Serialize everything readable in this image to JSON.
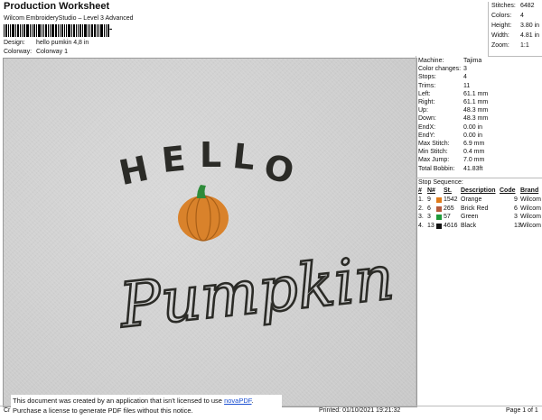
{
  "header": {
    "title": "Production Worksheet",
    "subtitle": "Wilcom EmbroideryStudio – Level 3 Advanced"
  },
  "barcode_text": "-",
  "design": {
    "label": "Design:",
    "value": "hello pumkin 4,8 in"
  },
  "colorway": {
    "label": "Colorway:",
    "value": "Colorway 1"
  },
  "stats": [
    {
      "label": "Stitches:",
      "value": "6482"
    },
    {
      "label": "Colors:",
      "value": "4"
    },
    {
      "label": "Height:",
      "value": "3.80 in"
    },
    {
      "label": "Width:",
      "value": "4.81 in"
    },
    {
      "label": "Zoom:",
      "value": "1:1"
    }
  ],
  "machine": [
    {
      "label": "Machine:",
      "value": "Tajima"
    },
    {
      "label": "Color changes:",
      "value": "3"
    },
    {
      "label": "Stops:",
      "value": "4"
    },
    {
      "label": "Trims:",
      "value": "11"
    },
    {
      "label": "Left:",
      "value": "61.1 mm"
    },
    {
      "label": "Right:",
      "value": "61.1 mm"
    },
    {
      "label": "Up:",
      "value": "48.3 mm"
    },
    {
      "label": "Down:",
      "value": "48.3 mm"
    },
    {
      "label": "EndX:",
      "value": "0.00 in"
    },
    {
      "label": "EndY:",
      "value": "0.00 in"
    },
    {
      "label": "Max Stitch:",
      "value": "6.9 mm"
    },
    {
      "label": "Min Stitch:",
      "value": "0.4 mm"
    },
    {
      "label": "Max Jump:",
      "value": "7.0 mm"
    },
    {
      "label": "Total Bobbin:",
      "value": "41.83ft"
    }
  ],
  "stop_sequence": {
    "title": "Stop Sequence:",
    "headers": [
      "#",
      "N#",
      "St.",
      "Description",
      "Code",
      "Brand"
    ],
    "rows": [
      {
        "num": "1.",
        "n": "9",
        "st": "1542",
        "desc": "Orange",
        "code": "9",
        "brand": "Wilcom",
        "color": "#e07b1a"
      },
      {
        "num": "2.",
        "n": "6",
        "st": "265",
        "desc": "Brick Red",
        "code": "6",
        "brand": "Wilcom",
        "color": "#b4593a"
      },
      {
        "num": "3.",
        "n": "3",
        "st": "57",
        "desc": "Green",
        "code": "3",
        "brand": "Wilcom",
        "color": "#1f9a3a"
      },
      {
        "num": "4.",
        "n": "13",
        "st": "4616",
        "desc": "Black",
        "code": "13",
        "brand": "Wilcom",
        "color": "#111111"
      }
    ]
  },
  "artwork": {
    "word_top": "HELLO",
    "word_bottom": "Pumpkin",
    "thread_dark": "#2b2b27",
    "pumpkin_orange": "#d9822b",
    "stem_green": "#2e8b3a"
  },
  "notice": {
    "line1_prefix": "This document was created by an application that isn't licensed to use ",
    "link": "novaPDF",
    "line1_suffix": ".",
    "line2": "Purchase a license to generate PDF files without this notice."
  },
  "footer": {
    "left": "Cr",
    "printed": "Printed: 01/10/2021 19:21:32",
    "page": "Page 1 of 1"
  }
}
